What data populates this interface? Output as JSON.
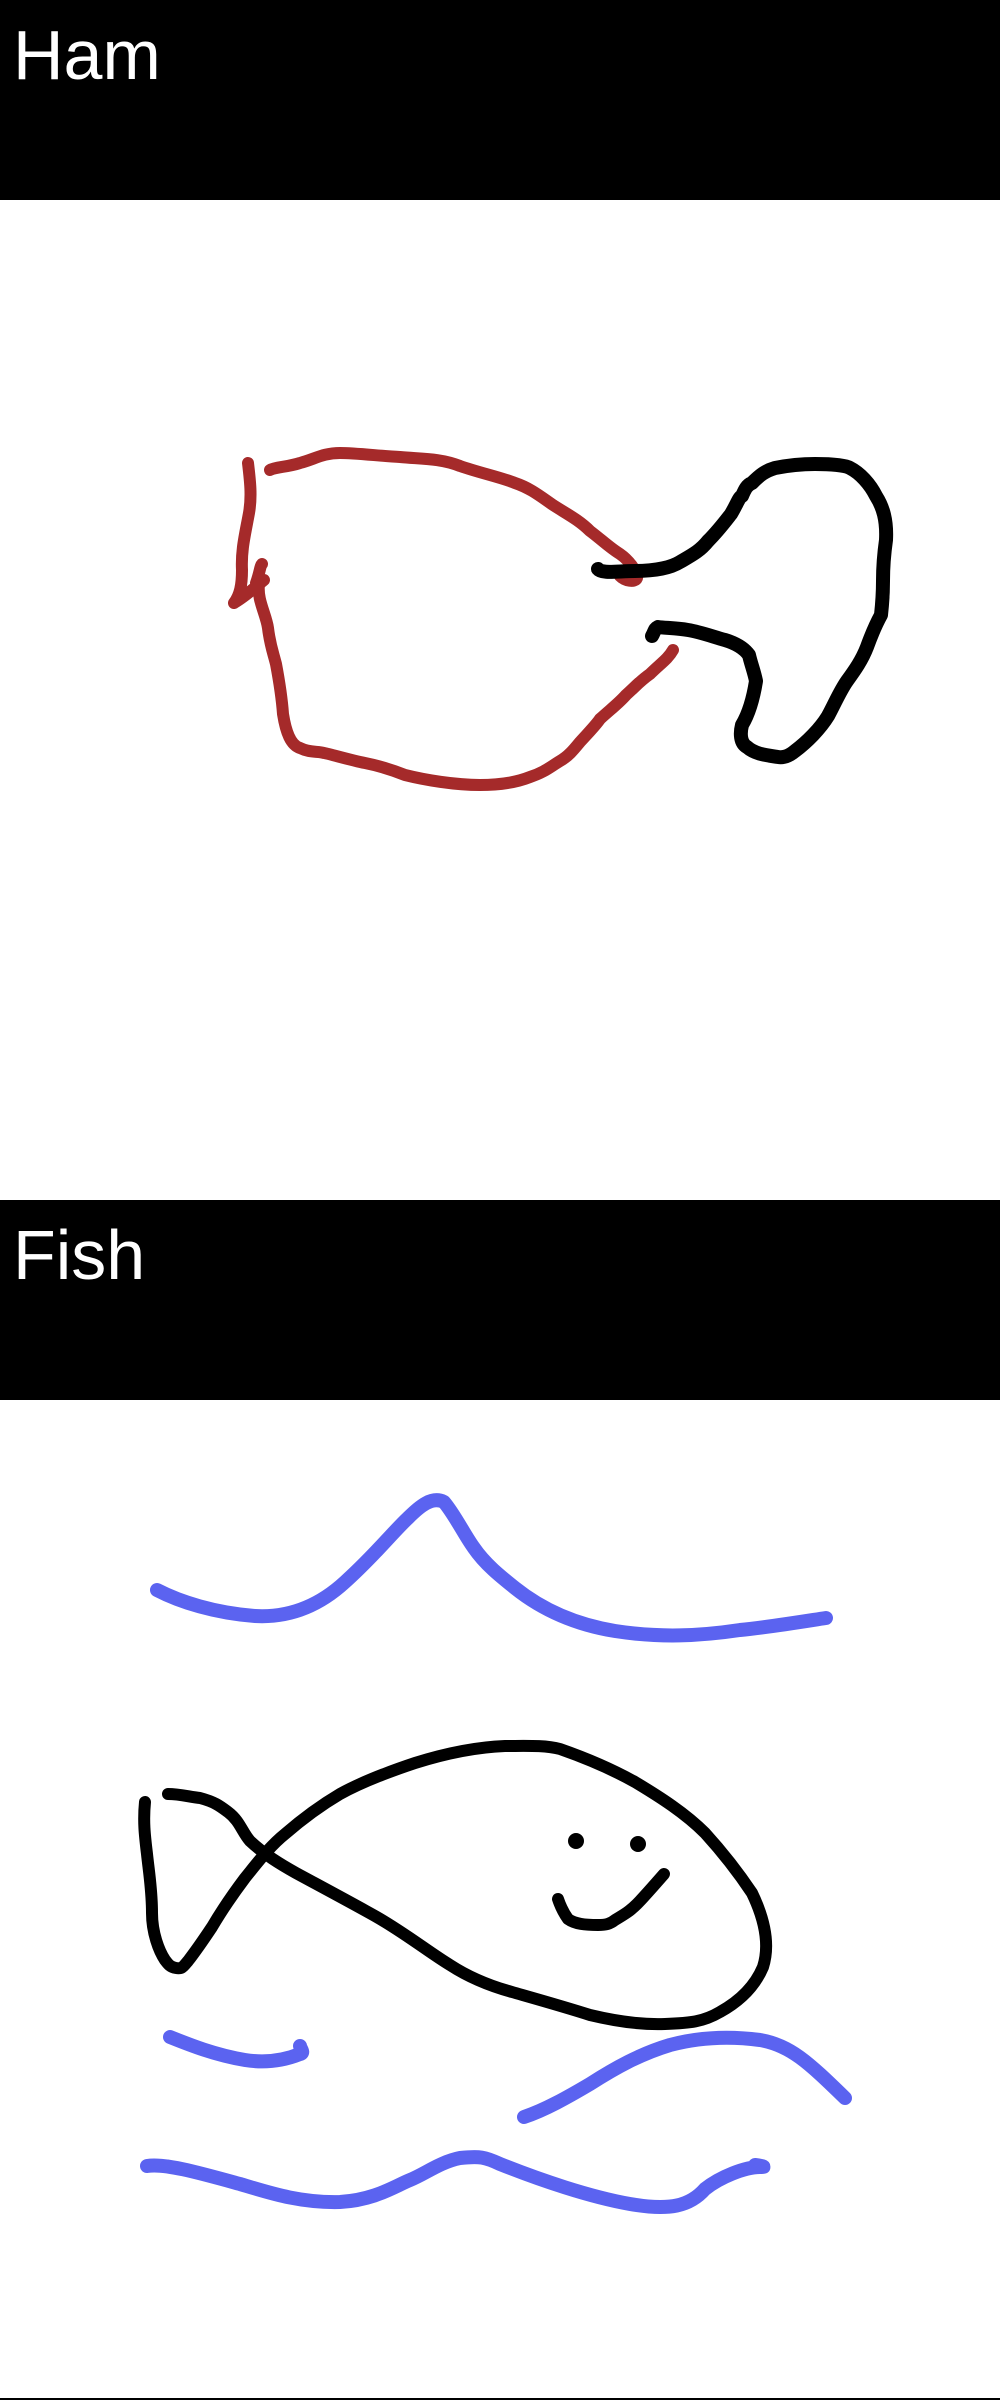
{
  "drawings": [
    {
      "title": "Ham",
      "icon": "ham-drawing",
      "stroke_colors": [
        "#a52a2a",
        "#000000"
      ]
    },
    {
      "title": "Fish",
      "icon": "fish-drawing",
      "stroke_colors": [
        "#000000",
        "#5b63f0"
      ]
    }
  ]
}
